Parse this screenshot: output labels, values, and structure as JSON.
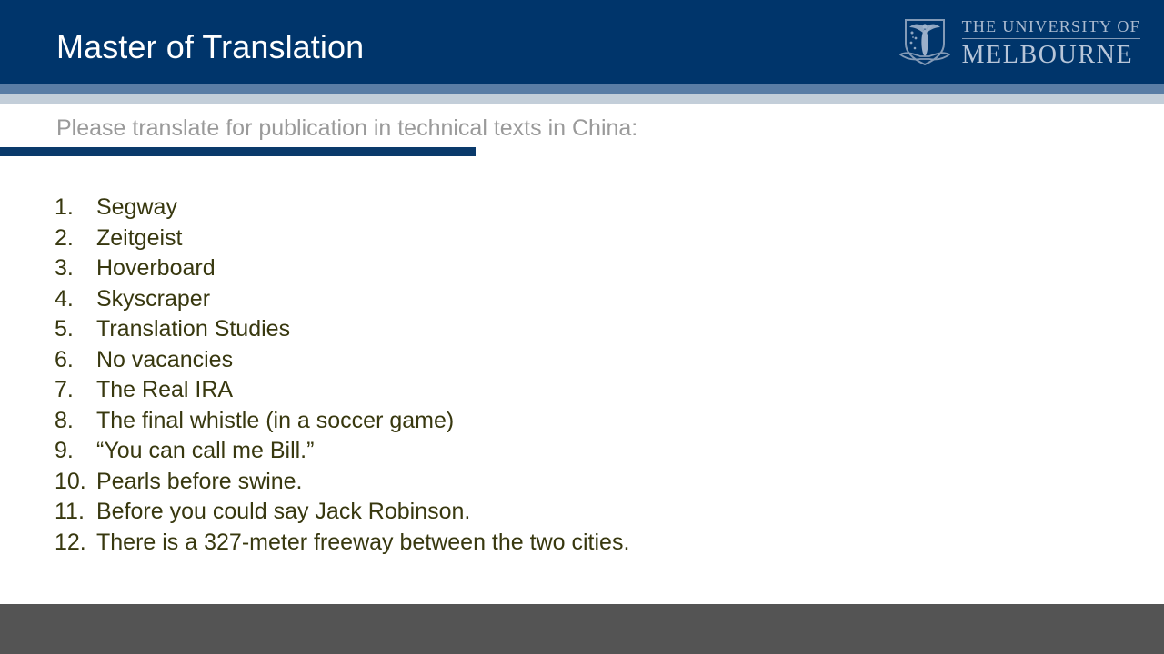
{
  "slide": {
    "title": "Master of Translation",
    "subtitle": "Please translate for publication in technical texts in China:"
  },
  "logo": {
    "crest_name": "university-of-melbourne-crest",
    "line_top": "THE UNIVERSITY OF",
    "line_bottom": "MELBOURNE"
  },
  "list": {
    "items": [
      {
        "number": "1.",
        "text": "Segway"
      },
      {
        "number": "2.",
        "text": "Zeitgeist"
      },
      {
        "number": "3.",
        "text": "Hoverboard"
      },
      {
        "number": "4.",
        "text": "Skyscraper"
      },
      {
        "number": "5.",
        "text": "Translation Studies"
      },
      {
        "number": "6.",
        "text": "No vacancies"
      },
      {
        "number": "7.",
        "text": "The Real IRA"
      },
      {
        "number": "8.",
        "text": "The final whistle (in a soccer game)"
      },
      {
        "number": "9.",
        "text": "“You can call me Bill.”"
      },
      {
        "number": "10.",
        "text": "Pearls before swine."
      },
      {
        "number": "11.",
        "text": "Before you could say Jack Robinson."
      },
      {
        "number": "12.",
        "text": "There is a 327-meter freeway between the two cities."
      }
    ]
  },
  "colors": {
    "header_navy": "#00356b",
    "header_mid_blue": "#5a7da5",
    "header_light_blue": "#c3ced9",
    "underline_navy": "#0a3a6b",
    "subtitle_gray": "#9a9a9a",
    "body_text": "#38380f",
    "footer_gray": "#545454"
  }
}
